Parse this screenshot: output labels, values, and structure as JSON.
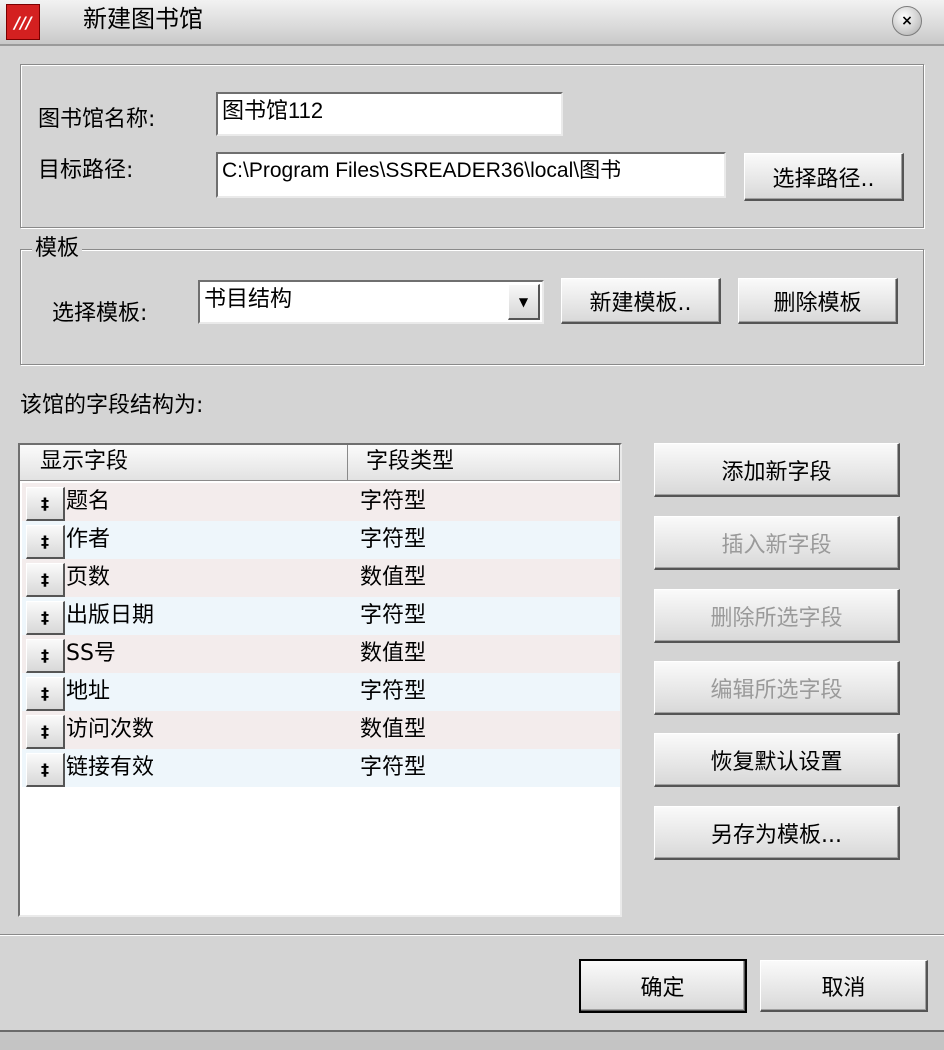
{
  "window": {
    "title": "新建图书馆",
    "logo_text": "///",
    "close_glyph": "×"
  },
  "library": {
    "name_label": "图书馆名称:",
    "name_value": "图书馆112",
    "path_label": "目标路径:",
    "path_value": "C:\\Program Files\\SSREADER36\\local\\图书",
    "choose_path_button": "选择路径.."
  },
  "template": {
    "group_title": "模板",
    "select_label": "选择模板:",
    "selected": "书目结构",
    "dropdown_glyph": "▼",
    "new_button": "新建模板..",
    "delete_button": "删除模板"
  },
  "fields": {
    "heading": "该馆的字段结构为:",
    "columns": [
      "显示字段",
      "字段类型"
    ],
    "handle_glyph": "‡",
    "rows": [
      {
        "name": "题名",
        "type": "字符型"
      },
      {
        "name": "作者",
        "type": "字符型"
      },
      {
        "name": "页数",
        "type": "数值型"
      },
      {
        "name": "出版日期",
        "type": "字符型"
      },
      {
        "name": "SS号",
        "type": "数值型"
      },
      {
        "name": "地址",
        "type": "字符型"
      },
      {
        "name": "访问次数",
        "type": "数值型"
      },
      {
        "name": "链接有效",
        "type": "字符型"
      }
    ]
  },
  "actions": {
    "add_field": "添加新字段",
    "insert_field": "插入新字段",
    "delete_selected": "删除所选字段",
    "edit_selected": "编辑所选字段",
    "restore_defaults": "恢复默认设置",
    "save_as_template": "另存为模板..."
  },
  "footer": {
    "ok": "确定",
    "cancel": "取消"
  }
}
